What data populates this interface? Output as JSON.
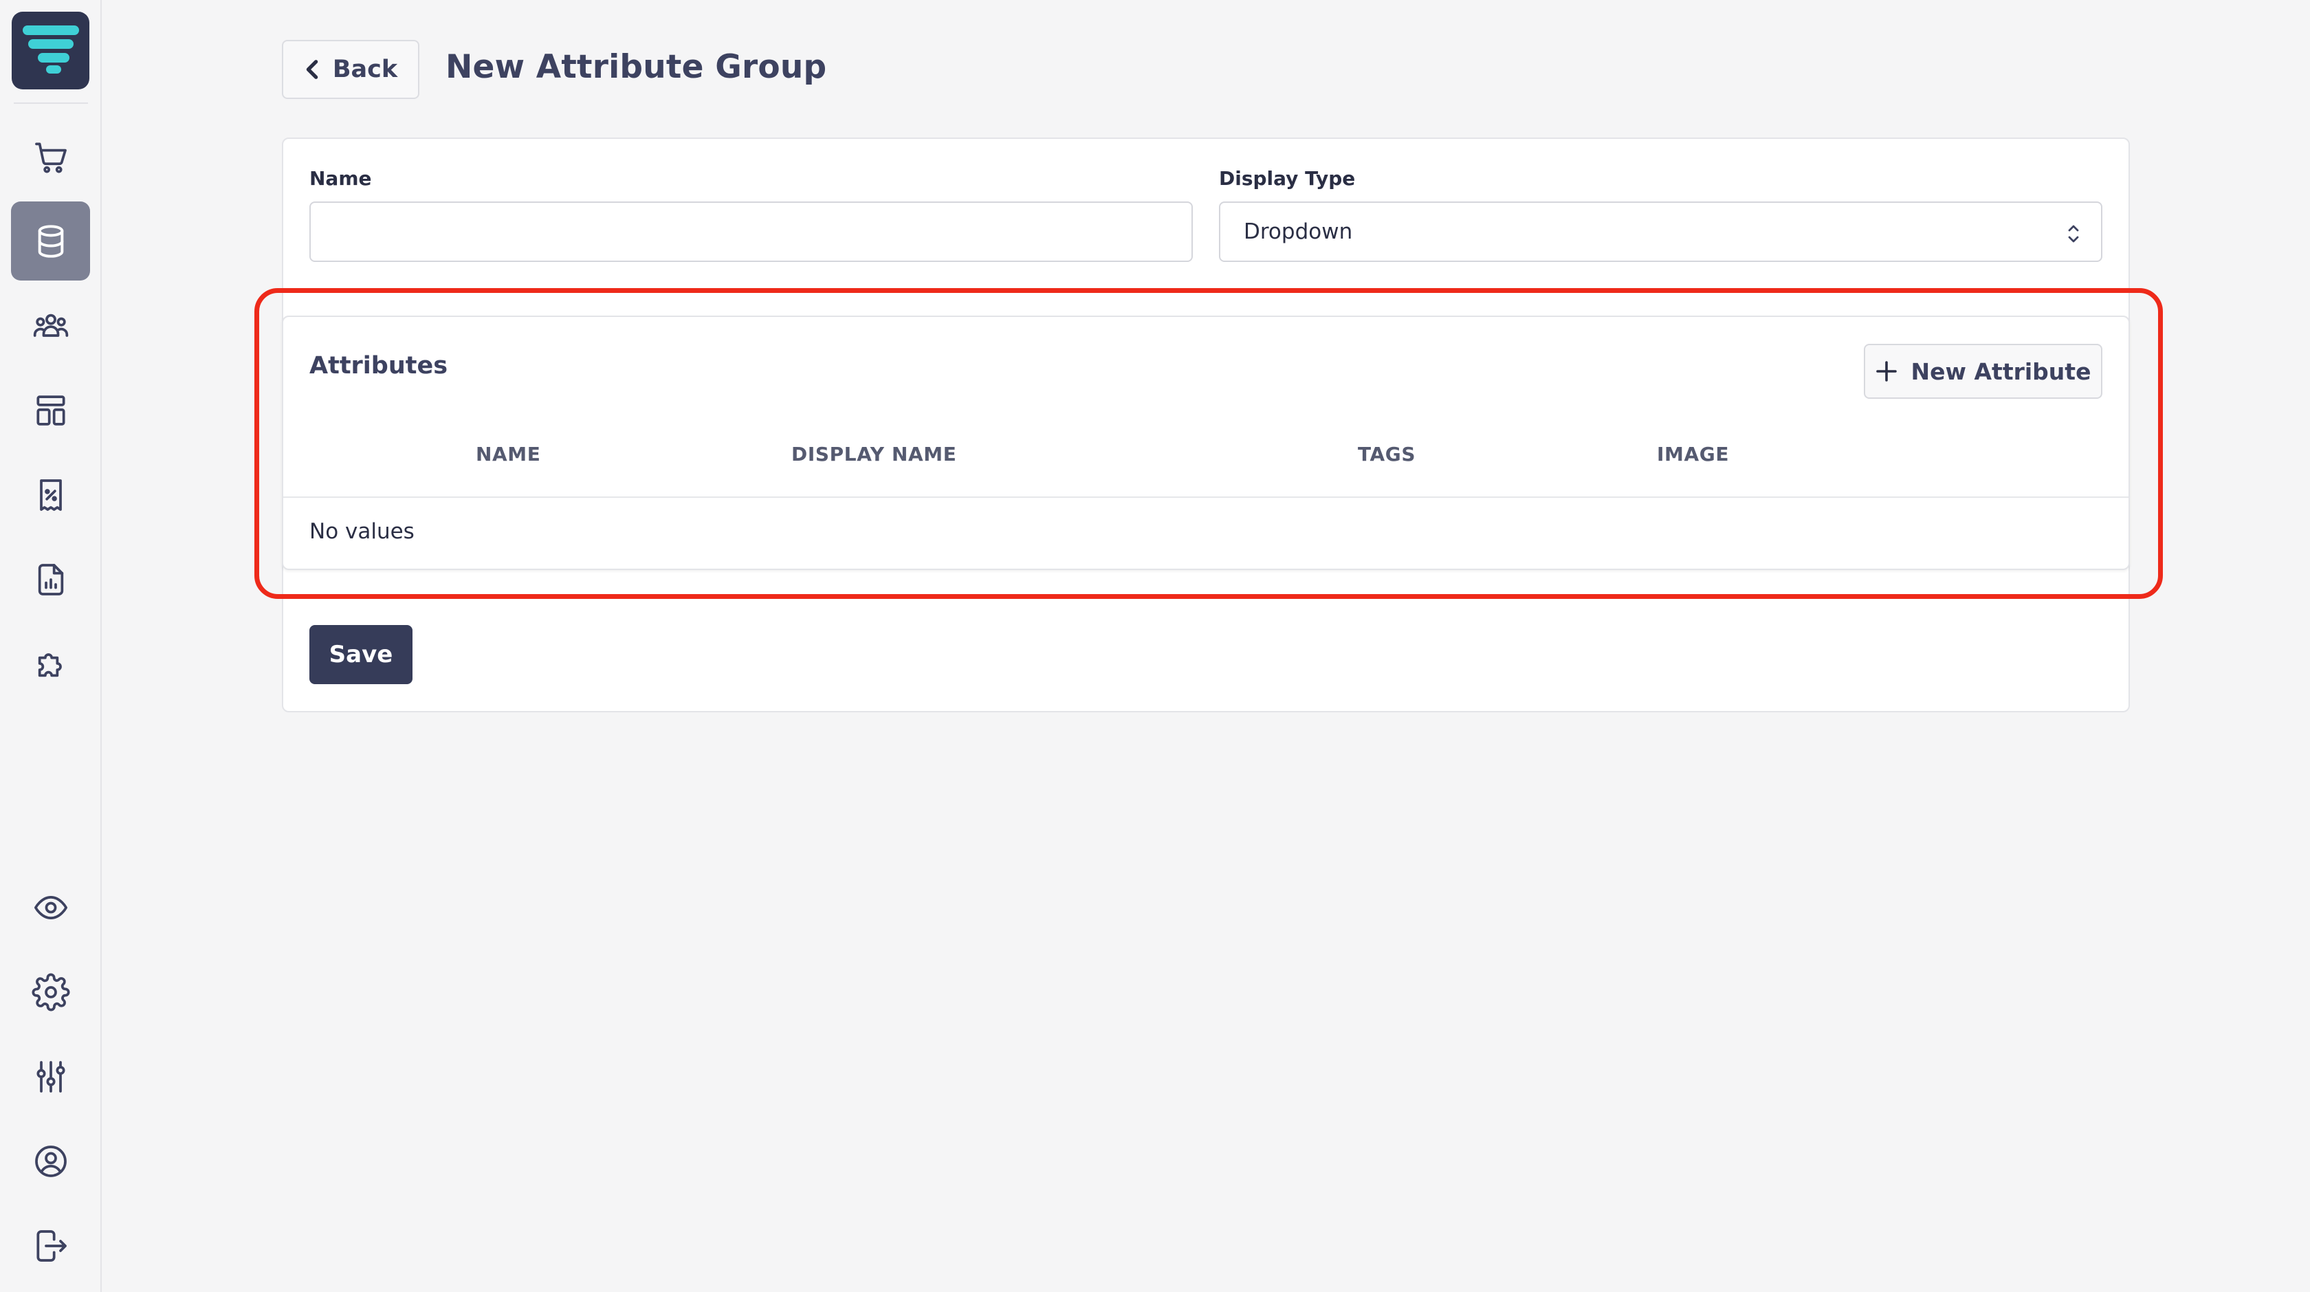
{
  "header": {
    "back_label": "Back",
    "title": "New Attribute Group"
  },
  "form": {
    "name_label": "Name",
    "name_value": "",
    "display_type_label": "Display Type",
    "display_type_value": "Dropdown"
  },
  "attributes": {
    "title": "Attributes",
    "new_button_label": "New Attribute",
    "columns": [
      "NAME",
      "DISPLAY NAME",
      "TAGS",
      "IMAGE"
    ],
    "rows": [],
    "empty_text": "No values"
  },
  "actions": {
    "save_label": "Save"
  },
  "sidebar": {
    "items": [
      {
        "icon": "cart-icon",
        "active": false
      },
      {
        "icon": "database-icon",
        "active": true
      },
      {
        "icon": "users-icon",
        "active": false
      },
      {
        "icon": "layout-icon",
        "active": false
      },
      {
        "icon": "discount-receipt-icon",
        "active": false
      },
      {
        "icon": "report-icon",
        "active": false
      },
      {
        "icon": "puzzle-icon",
        "active": false
      }
    ],
    "bottom_items": [
      {
        "icon": "eye-icon"
      },
      {
        "icon": "gear-icon"
      },
      {
        "icon": "sliders-icon"
      },
      {
        "icon": "user-circle-icon"
      },
      {
        "icon": "logout-icon"
      }
    ]
  },
  "colors": {
    "brand_dark": "#2f3550",
    "logo_accent": "#3fd0d6",
    "highlight": "#ee2a1a",
    "primary_button": "#363c59"
  }
}
